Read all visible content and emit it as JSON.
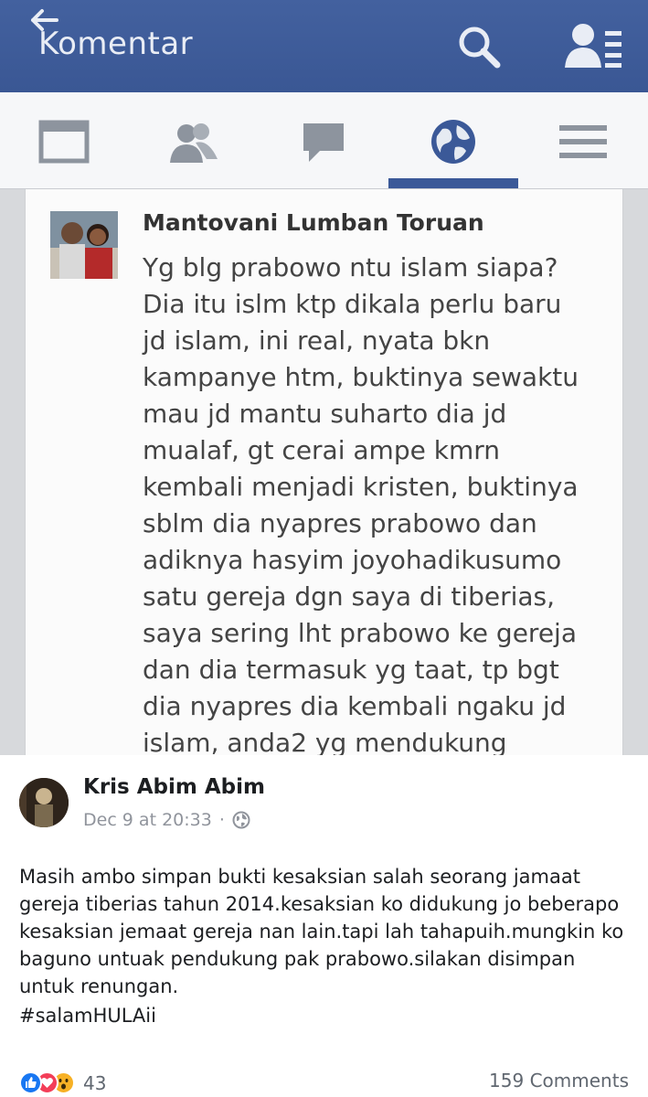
{
  "app_header": {
    "title": "Komentar"
  },
  "nav_tabs": [
    "news-feed",
    "friends",
    "messages",
    "notifications",
    "menu"
  ],
  "comment": {
    "author": "Mantovani Lumban Toruan",
    "lines": [
      "Yg blg prabowo ntu islam siapa?",
      "Dia itu islm ktp dikala perlu baru",
      "jd islam, ini real, nyata bkn",
      "kampanye htm, buktinya sewaktu",
      "mau jd mantu suharto dia jd",
      "mualaf, gt cerai ampe kmrn",
      "kembali menjadi kristen, buktinya",
      "sblm dia nyapres prabowo dan",
      "adiknya hasyim joyohadikusumo",
      "satu gereja dgn saya di tiberias,",
      "saya sering lht prabowo ke gereja",
      "dan dia termasuk yg taat, tp bgt",
      "dia nyapres dia kembali ngaku jd",
      "islam, anda2 yg mendukung"
    ]
  },
  "post": {
    "author": "Kris Abim Abim",
    "timestamp": "Dec 9 at 20:33",
    "separator": "·",
    "text": "Masih ambo simpan bukti kesaksian salah seorang jamaat gereja tiberias tahun 2014.kesaksian ko didukung jo beberapo kesaksian jemaat gereja nan lain.tapi lah tahapuih.mungkin ko baguno untuak pendukung pak prabowo.silakan disimpan untuk renungan.",
    "hashtag": "#salamHULAii",
    "reaction_count": "43",
    "comments_label": "159 Comments",
    "reaction_icons": [
      "like-icon",
      "love-icon",
      "wow-icon"
    ]
  },
  "colors": {
    "header_blue": "#3b5998",
    "like_blue": "#1877f2",
    "love_red": "#f33e58",
    "wow_yellow": "#f7b125"
  }
}
